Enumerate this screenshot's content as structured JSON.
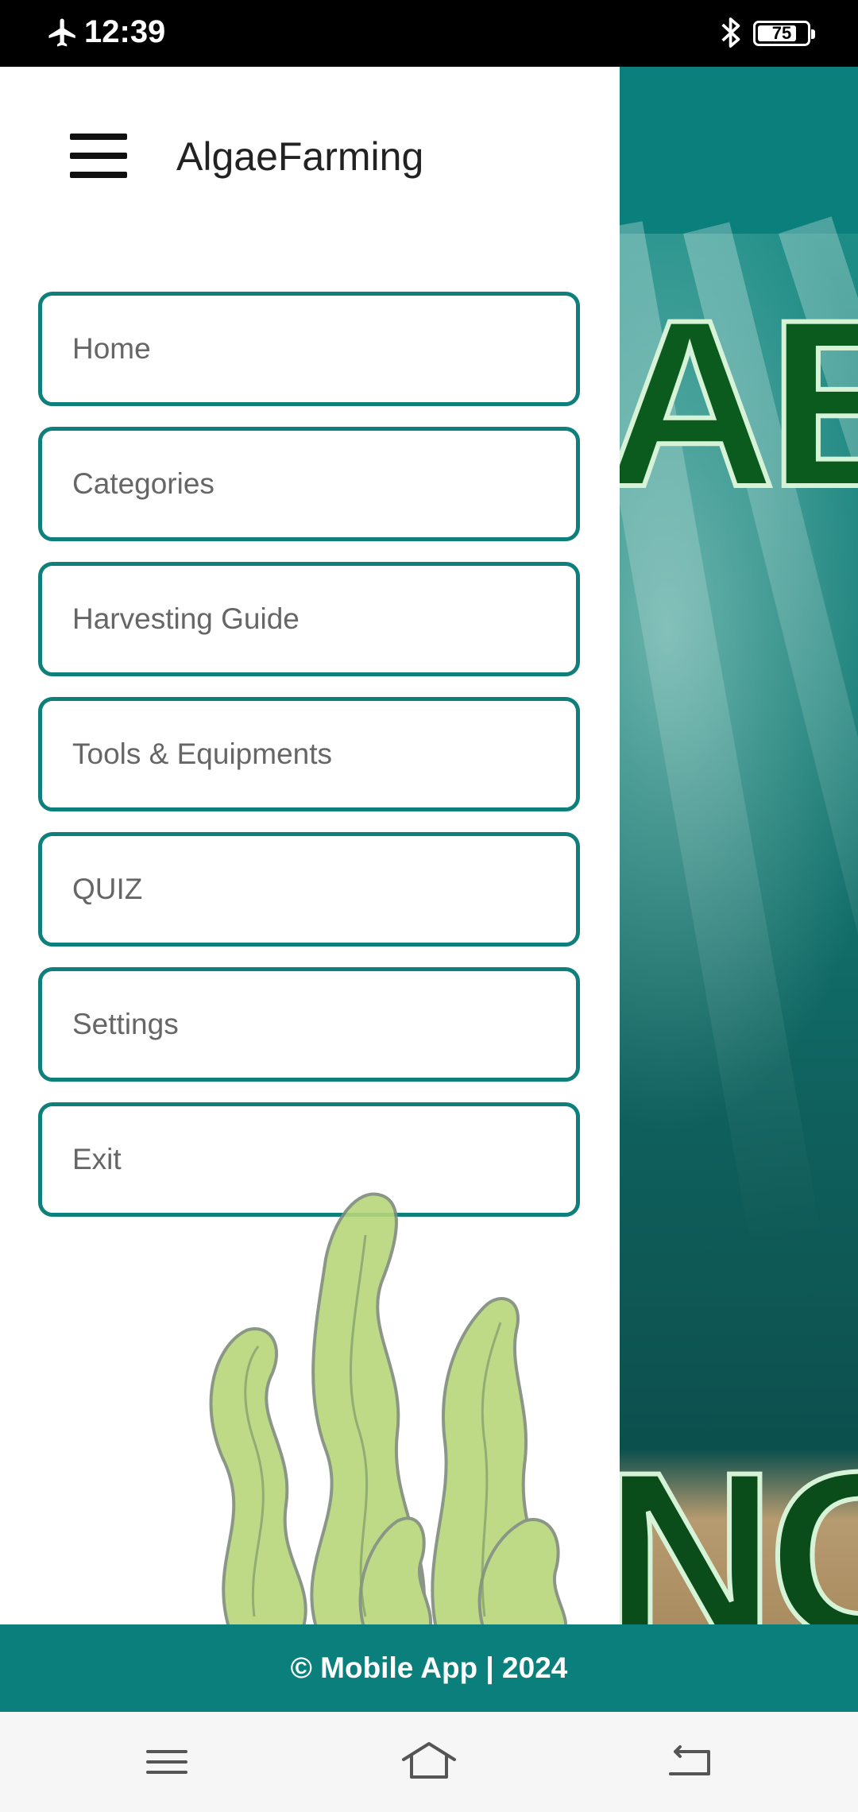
{
  "status_bar": {
    "time": "12:39",
    "battery_level": "75",
    "icons": [
      "airplane-mode-icon",
      "bluetooth-icon",
      "battery-icon"
    ]
  },
  "drawer": {
    "app_title": "AlgaeFarming",
    "menu_icon": "hamburger-menu-icon",
    "items": [
      {
        "label": "Home"
      },
      {
        "label": "Categories"
      },
      {
        "label": "Harvesting Guide"
      },
      {
        "label": "Tools & Equipments"
      },
      {
        "label": "QUIZ"
      },
      {
        "label": "Settings"
      },
      {
        "label": "Exit"
      }
    ]
  },
  "background": {
    "hero_text_top": "AE",
    "hero_text_bottom": "NG"
  },
  "footer": {
    "copyright": "© Mobile App | 2024"
  },
  "system_nav": {
    "icons": [
      "recents-icon",
      "home-icon",
      "back-icon"
    ]
  },
  "colors": {
    "accent": "#0a7f7c",
    "item_border": "#0f7f7b",
    "item_text": "#666666",
    "status_bar": "#000000"
  }
}
